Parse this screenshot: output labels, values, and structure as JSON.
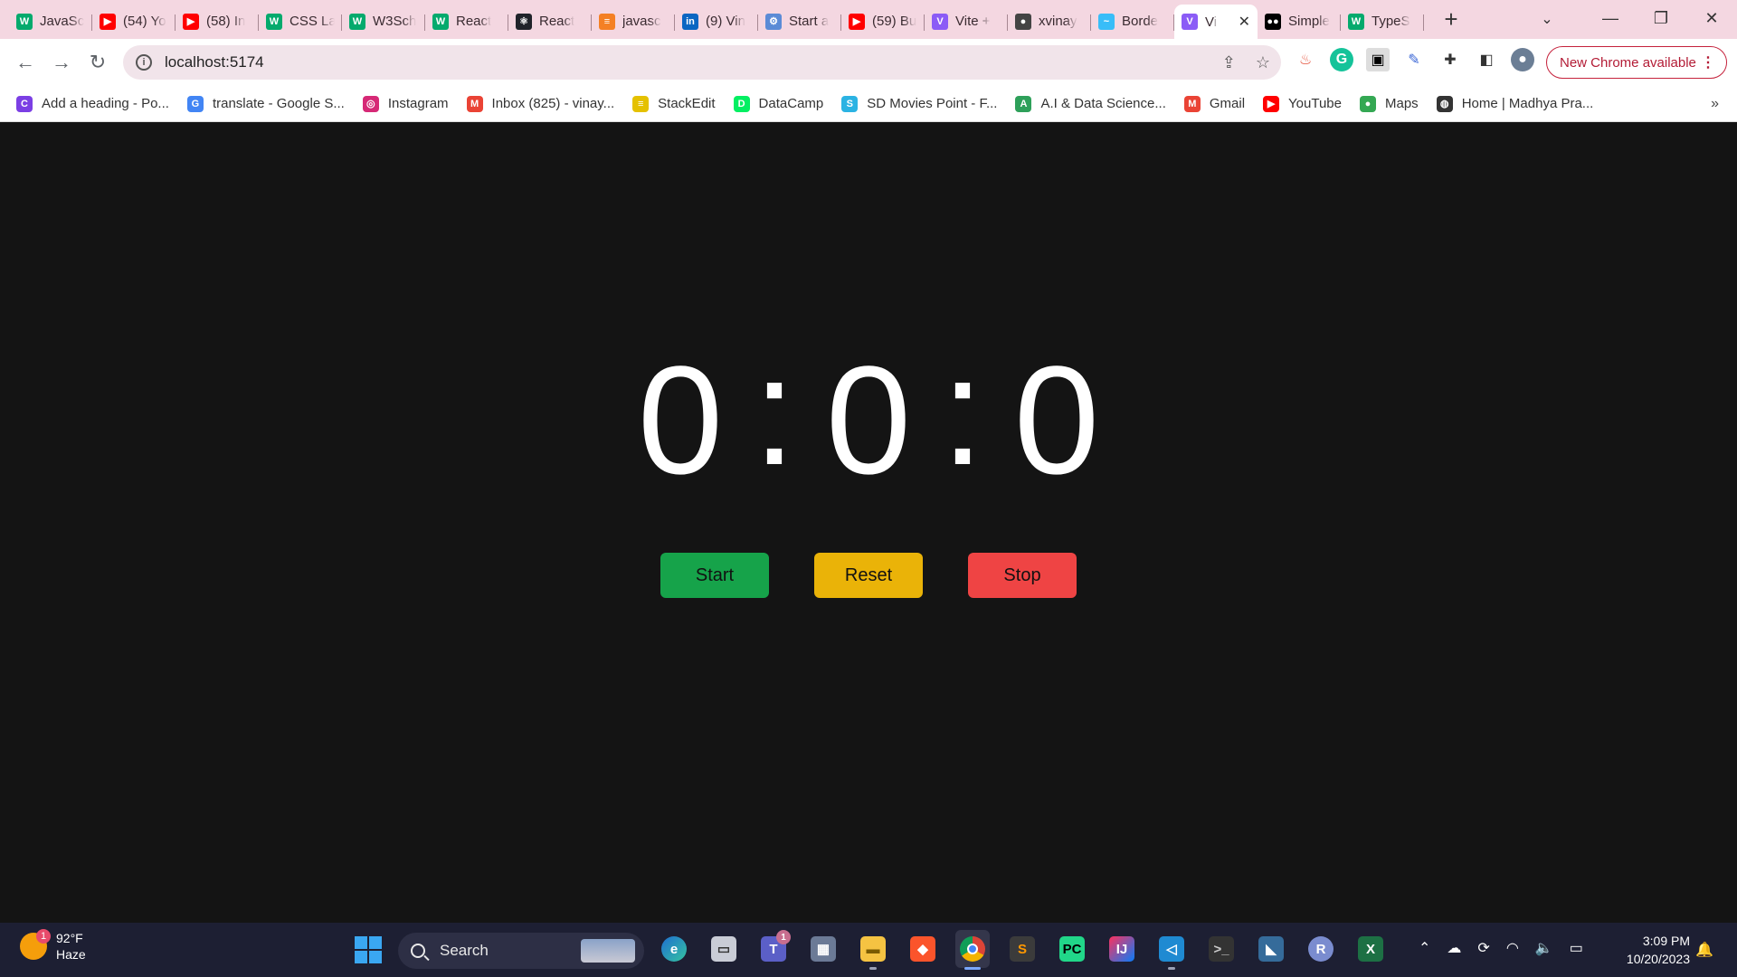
{
  "browser": {
    "tabs": [
      {
        "title": "JavaSc",
        "icon": "w3schools-icon",
        "fav": "W",
        "color": "#04aa6d"
      },
      {
        "title": "(54) Yo",
        "icon": "youtube-icon",
        "fav": "▶",
        "color": "#ff0000"
      },
      {
        "title": "(58) In",
        "icon": "youtube-icon",
        "fav": "▶",
        "color": "#ff0000"
      },
      {
        "title": "CSS La",
        "icon": "w3schools-icon",
        "fav": "W",
        "color": "#04aa6d"
      },
      {
        "title": "W3Sch",
        "icon": "w3schools-icon",
        "fav": "W",
        "color": "#04aa6d"
      },
      {
        "title": "React",
        "icon": "w3schools-icon",
        "fav": "W",
        "color": "#04aa6d"
      },
      {
        "title": "React",
        "icon": "react-icon",
        "fav": "⚛",
        "color": "#20232a"
      },
      {
        "title": "javasc",
        "icon": "stackoverflow-icon",
        "fav": "≡",
        "color": "#f48024"
      },
      {
        "title": "(9) Vin",
        "icon": "linkedin-icon",
        "fav": "in",
        "color": "#0a66c2"
      },
      {
        "title": "Start a",
        "icon": "gear-icon",
        "fav": "⚙",
        "color": "#5b8bd6"
      },
      {
        "title": "(59) Bu",
        "icon": "youtube-icon",
        "fav": "▶",
        "color": "#ff0000"
      },
      {
        "title": "Vite +",
        "icon": "vite-icon",
        "fav": "V",
        "color": "#8b5cf6"
      },
      {
        "title": "xvinay",
        "icon": "github-icon",
        "fav": "●",
        "color": "#444"
      },
      {
        "title": "Borde",
        "icon": "tailwind-icon",
        "fav": "~",
        "color": "#38bdf8"
      },
      {
        "title": "Vi",
        "icon": "vite-icon",
        "fav": "V",
        "color": "#8b5cf6",
        "active": true
      },
      {
        "title": "Simple",
        "icon": "medium-icon",
        "fav": "●●",
        "color": "#000"
      },
      {
        "title": "TypeS",
        "icon": "w3schools-icon",
        "fav": "W",
        "color": "#04aa6d"
      }
    ],
    "url": "localhost:5174",
    "chrome_update_label": "New Chrome available",
    "bookmarks": [
      {
        "label": "Add a heading - Po...",
        "icon": "canva-icon",
        "fav": "C",
        "color": "#7b3fe4"
      },
      {
        "label": "translate - Google S...",
        "icon": "google-icon",
        "fav": "G",
        "color": "#4285f4"
      },
      {
        "label": "Instagram",
        "icon": "instagram-icon",
        "fav": "◎",
        "color": "#d62976"
      },
      {
        "label": "Inbox (825) - vinay...",
        "icon": "gmail-icon",
        "fav": "M",
        "color": "#ea4335"
      },
      {
        "label": "StackEdit",
        "icon": "stackedit-icon",
        "fav": "≡",
        "color": "#e5c100"
      },
      {
        "label": "DataCamp",
        "icon": "datacamp-icon",
        "fav": "D",
        "color": "#03ef62"
      },
      {
        "label": "SD Movies Point - F...",
        "icon": "sdmovies-icon",
        "fav": "S",
        "color": "#2bb3e3"
      },
      {
        "label": "A.I & Data Science...",
        "icon": "ai-icon",
        "fav": "A",
        "color": "#2ea05a"
      },
      {
        "label": "Gmail",
        "icon": "gmail-icon",
        "fav": "M",
        "color": "#ea4335"
      },
      {
        "label": "YouTube",
        "icon": "youtube-icon",
        "fav": "▶",
        "color": "#ff0000"
      },
      {
        "label": "Maps",
        "icon": "maps-icon",
        "fav": "●",
        "color": "#34a853"
      },
      {
        "label": "Home | Madhya Pra...",
        "icon": "globe-icon",
        "fav": "◍",
        "color": "#333"
      }
    ]
  },
  "stopwatch": {
    "hours": "0",
    "sep1": ":",
    "minutes": "0",
    "sep2": ":",
    "seconds": "0",
    "buttons": {
      "start": "Start",
      "reset": "Reset",
      "stop": "Stop"
    },
    "colors": {
      "start": "#16a34a",
      "reset": "#eab308",
      "stop": "#ef4444"
    }
  },
  "taskbar": {
    "weather": {
      "temp": "92°F",
      "condition": "Haze",
      "badge": "1"
    },
    "search_placeholder": "Search",
    "teams_badge": "1",
    "time": "3:09 PM",
    "date": "10/20/2023"
  }
}
